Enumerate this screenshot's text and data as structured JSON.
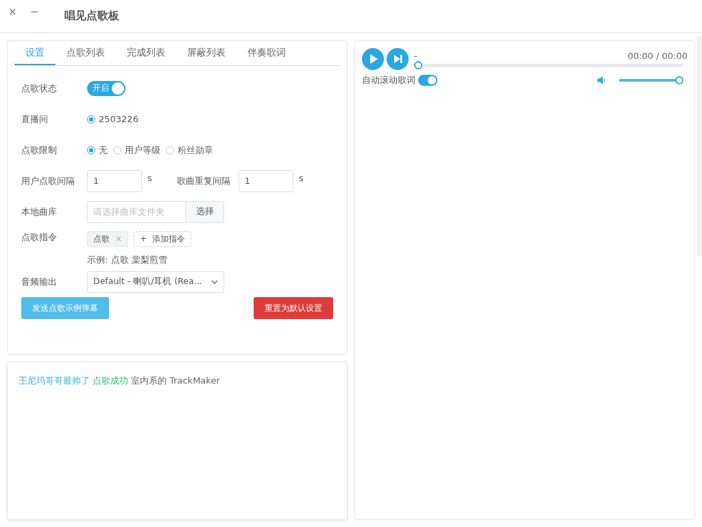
{
  "window": {
    "title": "唱见点歌板",
    "close": "×",
    "minimize": "−"
  },
  "tabs": [
    {
      "label": "设置",
      "selected": true
    },
    {
      "label": "点歌列表",
      "selected": false
    },
    {
      "label": "完成列表",
      "selected": false
    },
    {
      "label": "屏蔽列表",
      "selected": false
    },
    {
      "label": "伴奏歌词",
      "selected": false
    }
  ],
  "settings": {
    "status": {
      "label": "点歌状态",
      "on": true,
      "text": "开启"
    },
    "room": {
      "label": "直播间",
      "options": [
        {
          "label": "2503226",
          "selected": true
        }
      ]
    },
    "limit": {
      "label": "点歌限制",
      "options": [
        {
          "label": "无",
          "selected": true
        },
        {
          "label": "用户等级",
          "selected": false
        },
        {
          "label": "粉丝勋章",
          "selected": false
        }
      ]
    },
    "user_interval": {
      "label": "用户点歌间隔",
      "value": "1",
      "unit": "s"
    },
    "repeat_interval": {
      "label": "歌曲重复间隔",
      "value": "1",
      "unit": "s"
    },
    "library": {
      "label": "本地曲库",
      "placeholder": "请选择曲库文件夹",
      "button": "选择"
    },
    "command": {
      "label": "点歌指令",
      "tags": [
        {
          "label": "点歌",
          "remove": "×"
        }
      ],
      "add_icon": "+",
      "add": "添加指令",
      "example": "示例: 点歌 棠梨煎雪"
    },
    "audio": {
      "label": "音频输出",
      "value": "Default - 喇叭/耳机 (Rea..."
    },
    "send_button": "发送点歌示例弹幕",
    "reset_button": "重置为默认设置"
  },
  "log": [
    {
      "user": "王尼玛哥哥最帅了",
      "status": "点歌成功",
      "song": "室内系的 TrackMaker"
    }
  ],
  "player": {
    "title": "-",
    "time": "00:00 / 00:00",
    "progress": {
      "level": 0
    },
    "autoscroll": {
      "label": "自动滚动歌词",
      "on": true
    },
    "volume": {
      "level": 1
    }
  }
}
